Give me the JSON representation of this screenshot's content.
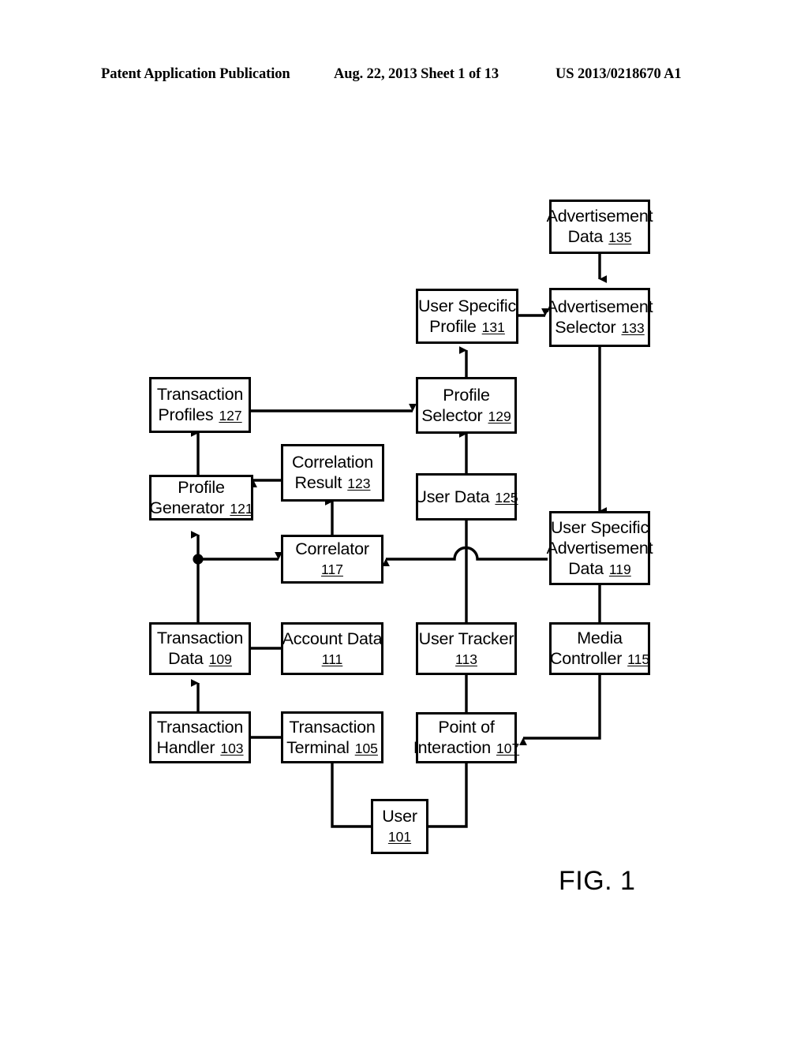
{
  "header": {
    "left": "Patent Application Publication",
    "middle": "Aug. 22, 2013  Sheet 1 of 13",
    "right": "US 2013/0218670 A1"
  },
  "figure": {
    "caption": "FIG. 1",
    "nodes": [
      {
        "id": "advertisement-data",
        "line1": "Advertisement",
        "line2": "Data",
        "ref": "135"
      },
      {
        "id": "advertisement-selector",
        "line1": "Advertisement",
        "line2": "Selector",
        "ref": "133"
      },
      {
        "id": "user-specific-profile",
        "line1": "User Specific",
        "line2": "Profile",
        "ref": "131"
      },
      {
        "id": "profile-selector",
        "line1": "Profile",
        "line2": "Selector",
        "ref": "129"
      },
      {
        "id": "transaction-profiles",
        "line1": "Transaction",
        "line2": "Profiles",
        "ref": "127"
      },
      {
        "id": "correlation-result",
        "line1": "Correlation",
        "line2": "Result",
        "ref": "123"
      },
      {
        "id": "user-data",
        "line1": "User Data",
        "line2": "",
        "ref": "125"
      },
      {
        "id": "profile-generator",
        "line1": "Profile",
        "line2": "Generator",
        "ref": "121"
      },
      {
        "id": "correlator",
        "line1": "Correlator",
        "line2": "",
        "ref": "117"
      },
      {
        "id": "user-specific-advertisement-data",
        "line1": "User Specific",
        "line2": "Advertisement",
        "line3": "Data",
        "ref": "119"
      },
      {
        "id": "transaction-data",
        "line1": "Transaction",
        "line2": "Data",
        "ref": "109"
      },
      {
        "id": "account-data",
        "line1": "Account Data",
        "line2": "",
        "ref": "111"
      },
      {
        "id": "user-tracker",
        "line1": "User Tracker",
        "line2": "",
        "ref": "113"
      },
      {
        "id": "media-controller",
        "line1": "Media",
        "line2": "Controller",
        "ref": "115"
      },
      {
        "id": "transaction-handler",
        "line1": "Transaction",
        "line2": "Handler",
        "ref": "103"
      },
      {
        "id": "transaction-terminal",
        "line1": "Transaction",
        "line2": "Terminal",
        "ref": "105"
      },
      {
        "id": "point-of-interaction",
        "line1": "Point of",
        "line2": "Interaction",
        "ref": "107"
      },
      {
        "id": "user",
        "line1": "User",
        "line2": "",
        "ref": "101"
      }
    ]
  },
  "nodes": {
    "advertisement_data": {
      "l1": "Advertisement",
      "l2": "Data",
      "ref": "135"
    },
    "advertisement_selector": {
      "l1": "Advertisement",
      "l2": "Selector",
      "ref": "133"
    },
    "user_specific_profile": {
      "l1": "User Specific",
      "l2": "Profile",
      "ref": "131"
    },
    "profile_selector": {
      "l1": "Profile",
      "l2": "Selector",
      "ref": "129"
    },
    "transaction_profiles": {
      "l1": "Transaction",
      "l2": "Profiles",
      "ref": "127"
    },
    "correlation_result": {
      "l1": "Correlation",
      "l2": "Result",
      "ref": "123"
    },
    "user_data": {
      "l1": "User Data",
      "ref": "125"
    },
    "profile_generator": {
      "l1": "Profile",
      "l2": "Generator",
      "ref": "121"
    },
    "correlator": {
      "l1": "Correlator",
      "ref": "117"
    },
    "user_specific_advertisement_data": {
      "l1": "User Specific",
      "l2": "Advertisement",
      "l3": "Data",
      "ref": "119"
    },
    "transaction_data": {
      "l1": "Transaction",
      "l2": "Data",
      "ref": "109"
    },
    "account_data": {
      "l1": "Account Data",
      "ref": "111"
    },
    "user_tracker": {
      "l1": "User Tracker",
      "ref": "113"
    },
    "media_controller": {
      "l1": "Media",
      "l2": "Controller",
      "ref": "115"
    },
    "transaction_handler": {
      "l1": "Transaction",
      "l2": "Handler",
      "ref": "103"
    },
    "transaction_terminal": {
      "l1": "Transaction",
      "l2": "Terminal",
      "ref": "105"
    },
    "point_of_interaction": {
      "l1": "Point of",
      "l2": "Interaction",
      "ref": "107"
    },
    "user": {
      "l1": "User",
      "ref": "101"
    }
  },
  "connections": [
    {
      "from": "advertisement_data",
      "to": "advertisement_selector",
      "arrow": "down",
      "style": "arrow"
    },
    {
      "from": "user_specific_profile",
      "to": "advertisement_selector",
      "arrow": "right",
      "style": "arrow"
    },
    {
      "from": "profile_selector",
      "to": "user_specific_profile",
      "arrow": "up",
      "style": "arrow"
    },
    {
      "from": "transaction_profiles",
      "to": "profile_selector",
      "arrow": "right",
      "style": "arrow"
    },
    {
      "from": "profile_generator",
      "to": "transaction_profiles",
      "arrow": "up",
      "style": "arrow"
    },
    {
      "from": "correlation_result",
      "to": "profile_generator",
      "arrow": "left",
      "style": "arrow"
    },
    {
      "from": "correlator",
      "to": "correlation_result",
      "arrow": "up",
      "style": "arrow"
    },
    {
      "from": "user_data",
      "to": "profile_selector",
      "arrow": "up",
      "style": "arrow"
    },
    {
      "from": "advertisement_selector",
      "to": "user_specific_advertisement_data",
      "arrow": "down",
      "style": "arrow"
    },
    {
      "from": "user_specific_advertisement_data",
      "to": "correlator",
      "arrow": "left",
      "style": "arrow-with-hop"
    },
    {
      "from": "transaction_data",
      "to": "profile_generator",
      "arrow": "up",
      "style": "arrow-with-junction"
    },
    {
      "from": "transaction_data",
      "to": "correlator",
      "arrow": "right",
      "style": "arrow"
    },
    {
      "from": "transaction_handler",
      "to": "transaction_data",
      "arrow": "up",
      "style": "arrow"
    },
    {
      "from": "transaction_data",
      "to": "account_data",
      "arrow": "none",
      "style": "plain"
    },
    {
      "from": "transaction_handler",
      "to": "transaction_terminal",
      "arrow": "none",
      "style": "plain"
    },
    {
      "from": "user_tracker",
      "to": "user_data",
      "arrow": "up",
      "style": "arrow-with-hop"
    },
    {
      "from": "user_tracker",
      "to": "point_of_interaction",
      "arrow": "none",
      "style": "plain"
    },
    {
      "from": "media_controller",
      "to": "point_of_interaction",
      "arrow": "left",
      "style": "arrow"
    },
    {
      "from": "user_specific_advertisement_data",
      "to": "media_controller",
      "arrow": "none",
      "style": "plain"
    },
    {
      "from": "transaction_terminal",
      "to": "user",
      "arrow": "none",
      "style": "plain"
    },
    {
      "from": "point_of_interaction",
      "to": "user",
      "arrow": "none",
      "style": "plain"
    }
  ],
  "colors": {
    "stroke": "#000000",
    "background": "#ffffff"
  }
}
